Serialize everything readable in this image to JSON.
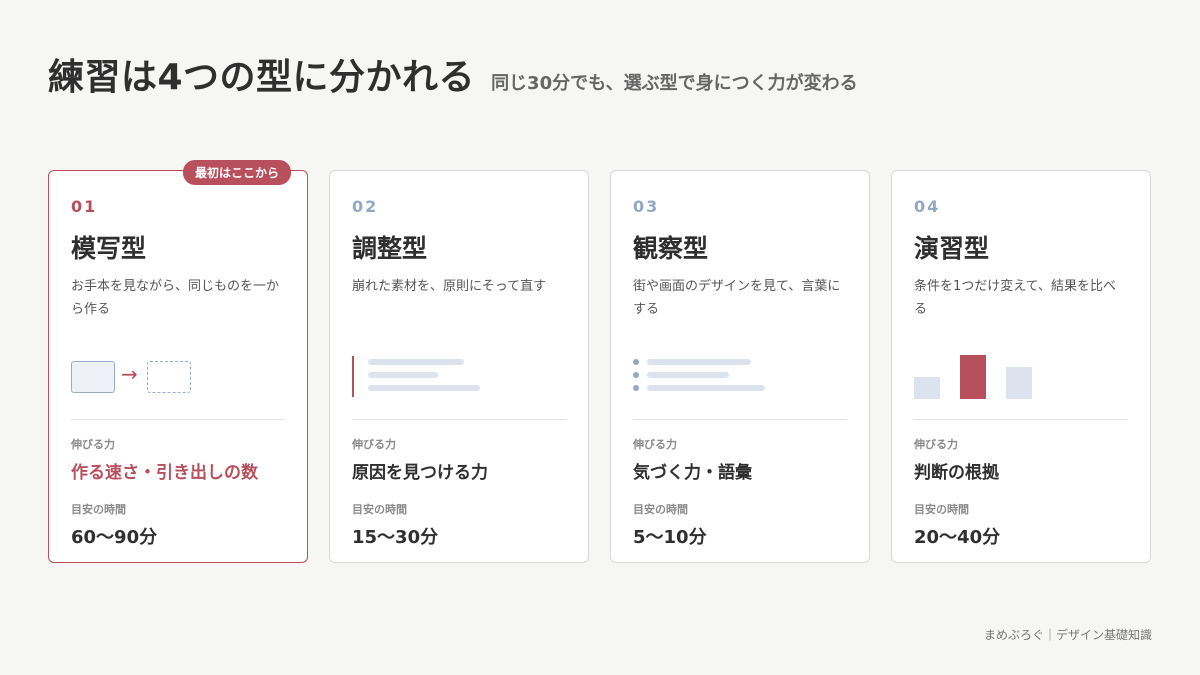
{
  "header": {
    "title": "練習は4つの型に分かれる",
    "subtitle": "同じ30分でも、選ぶ型で身につく力が変わる"
  },
  "labels": {
    "strength": "伸びる力",
    "time": "目安の時間"
  },
  "cards": [
    {
      "badge": "最初はここから",
      "number": "01",
      "name": "模写型",
      "description": "お手本を見ながら、同じものを一から作る",
      "strength": "作る速さ・引き出しの数",
      "time": "60〜90分",
      "illustration": "copy-boxes"
    },
    {
      "number": "02",
      "name": "調整型",
      "description": "崩れた素材を、原則にそって直す",
      "strength": "原因を見つける力",
      "time": "15〜30分",
      "illustration": "aligned-lines"
    },
    {
      "number": "03",
      "name": "観察型",
      "description": "街や画面のデザインを見て、言葉にする",
      "strength": "気づく力・語彙",
      "time": "5〜10分",
      "illustration": "bullet-list"
    },
    {
      "number": "04",
      "name": "演習型",
      "description": "条件を1つだけ変えて、結果を比べる",
      "strength": "判断の根拠",
      "time": "20〜40分",
      "illustration": "compare-bars",
      "bars": [
        0.5,
        1.0,
        0.72
      ]
    }
  ],
  "colors": {
    "accent": "#b84f5c",
    "muted_blue": "#94a8c6",
    "light_blue": "#dde3ee"
  },
  "footer": {
    "text": "まめぶろぐ｜デザイン基礎知識"
  }
}
